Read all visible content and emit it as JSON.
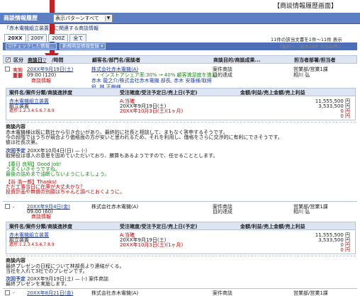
{
  "page_caption": "【商談情報履歴画面】",
  "header": {
    "title": "商談情報履歴",
    "pattern": "表示パターンすべて"
  },
  "sub_title": "「赤木電機組立装置」に関連する商談情報",
  "tabs": [
    "20XX",
    "200Y",
    "200Z",
    "全て"
  ],
  "toolbar": {
    "checked_btn": "☑チェックした情報...",
    "new_btn": "新規商談情報登録 ▾"
  },
  "count": {
    "text": "11件の該当文書を1件～11件 表示",
    "pager": "《最初へ 〈前の20件 次の20件〉"
  },
  "columns": {
    "kubun": "区分",
    "date": "商談日▽",
    "time": "/時間",
    "customer": "顧客名/部門名/面談者",
    "purpose": "商談目的/商談成果...",
    "person": "担当者部署/担当者"
  },
  "records": [
    {
      "status": "実施",
      "importance": "重要",
      "date": "20XX年9月19日(土)",
      "time": "09:00 (120)",
      "type": "商談情報",
      "customer": "株式会社赤木電機(A)",
      "cust_sub": "・インストアシェア率:30% → 40% 顧客満足度を満足",
      "attendees": "赤木 龍之介/株式会社赤木電機 部長, 赤木 安雄様/取締役, 林 正樹様",
      "purpose": "案件商談",
      "result": "目的達成",
      "dept": "営業部/営業1課",
      "staff": "相川 弘",
      "table_head": [
        "案件名/案件分類/商談進捗度",
        "受注確度/受注予定日/売上日(予定)",
        "金額/利益/売上金額/売上利益"
      ],
      "deal": {
        "name": "赤木電機組立装置",
        "category": "組立装置",
        "progress": "進捗:1.2.3.4.5.6.7.8.9",
        "rank": "A:当確",
        "order_date": "20XX年9月19日(土)",
        "sales_date": "20XX年10月3日(土)(1ヶ月)",
        "amount": "11,555,500 円",
        "profit": "3,533,500 円",
        "sales": "0 円",
        "sales_profit": "0 円"
      },
      "content_head": "商談内容",
      "content": [
        "赤木電機様は既に数社から引き合いがあり、最終的に社長と相談して、まもなく答申するそうです。",
        "今の段階ではうちが競合より価格面の方が安いと思われるため、それを利用し、価格をさらに交渉的に有利にできそうです。",
        "彼は社長次第。"
      ],
      "next_label": "次回予定",
      "next_text": "20XX年10月4日(日) — (-)",
      "next_note": "取締役は導入の意思を固めていただいており、勝算もあるようですので、任せることとします。",
      "comment1_head": "【春日 良明】Good Job!",
      "comment1": [
        "うまくいきそうですね。",
        "最後の詰めまで油断しないようにしましょう。"
      ],
      "comment2_head": "【谷 浩一郎】Thanks!",
      "comment2": [
        "ただ工事当日に在庫が大丈夫かな？",
        "投資計画や無償の別願はちゃんと調べとおくように。"
      ]
    },
    {
      "status": "-",
      "date": "20XX年9月4日(金)",
      "time": "09:00 (60)",
      "type": "商談情報",
      "customer": "株式会社赤木電機(A)",
      "purpose": "案件商談",
      "result": "目的達成",
      "dept": "営業部/営業1課",
      "staff": "相川 弘",
      "deal": {
        "name": "赤木電機組立装置",
        "category": "組立装置",
        "progress": "進捗:1.2.3.4.5.6.7.8.9",
        "rank": "A:当確",
        "order_date": "20XX年9月19日(土)",
        "sales_date": "20XX年10月3日(土)(1ヶ月)",
        "amount": "11,555,500 円",
        "profit": "3,533,500 円",
        "sales": "0 円",
        "sales_profit": "0 円"
      },
      "content": [
        "最終プレゼンの日程について林部長より連絡がくる。",
        "当社を入れて3社でのプレゼンです。"
      ],
      "next_label": "次回予定",
      "next_text": "20XX年9月19日(土) — (-) 案件商談",
      "next_note": "最終プレゼンを実施します。"
    },
    {
      "status": "-",
      "date": "20XX年8月21日(金)",
      "customer": "株式会社赤木電機(A)",
      "purpose": "案件商談",
      "dept": "営業部/営業1課"
    }
  ]
}
